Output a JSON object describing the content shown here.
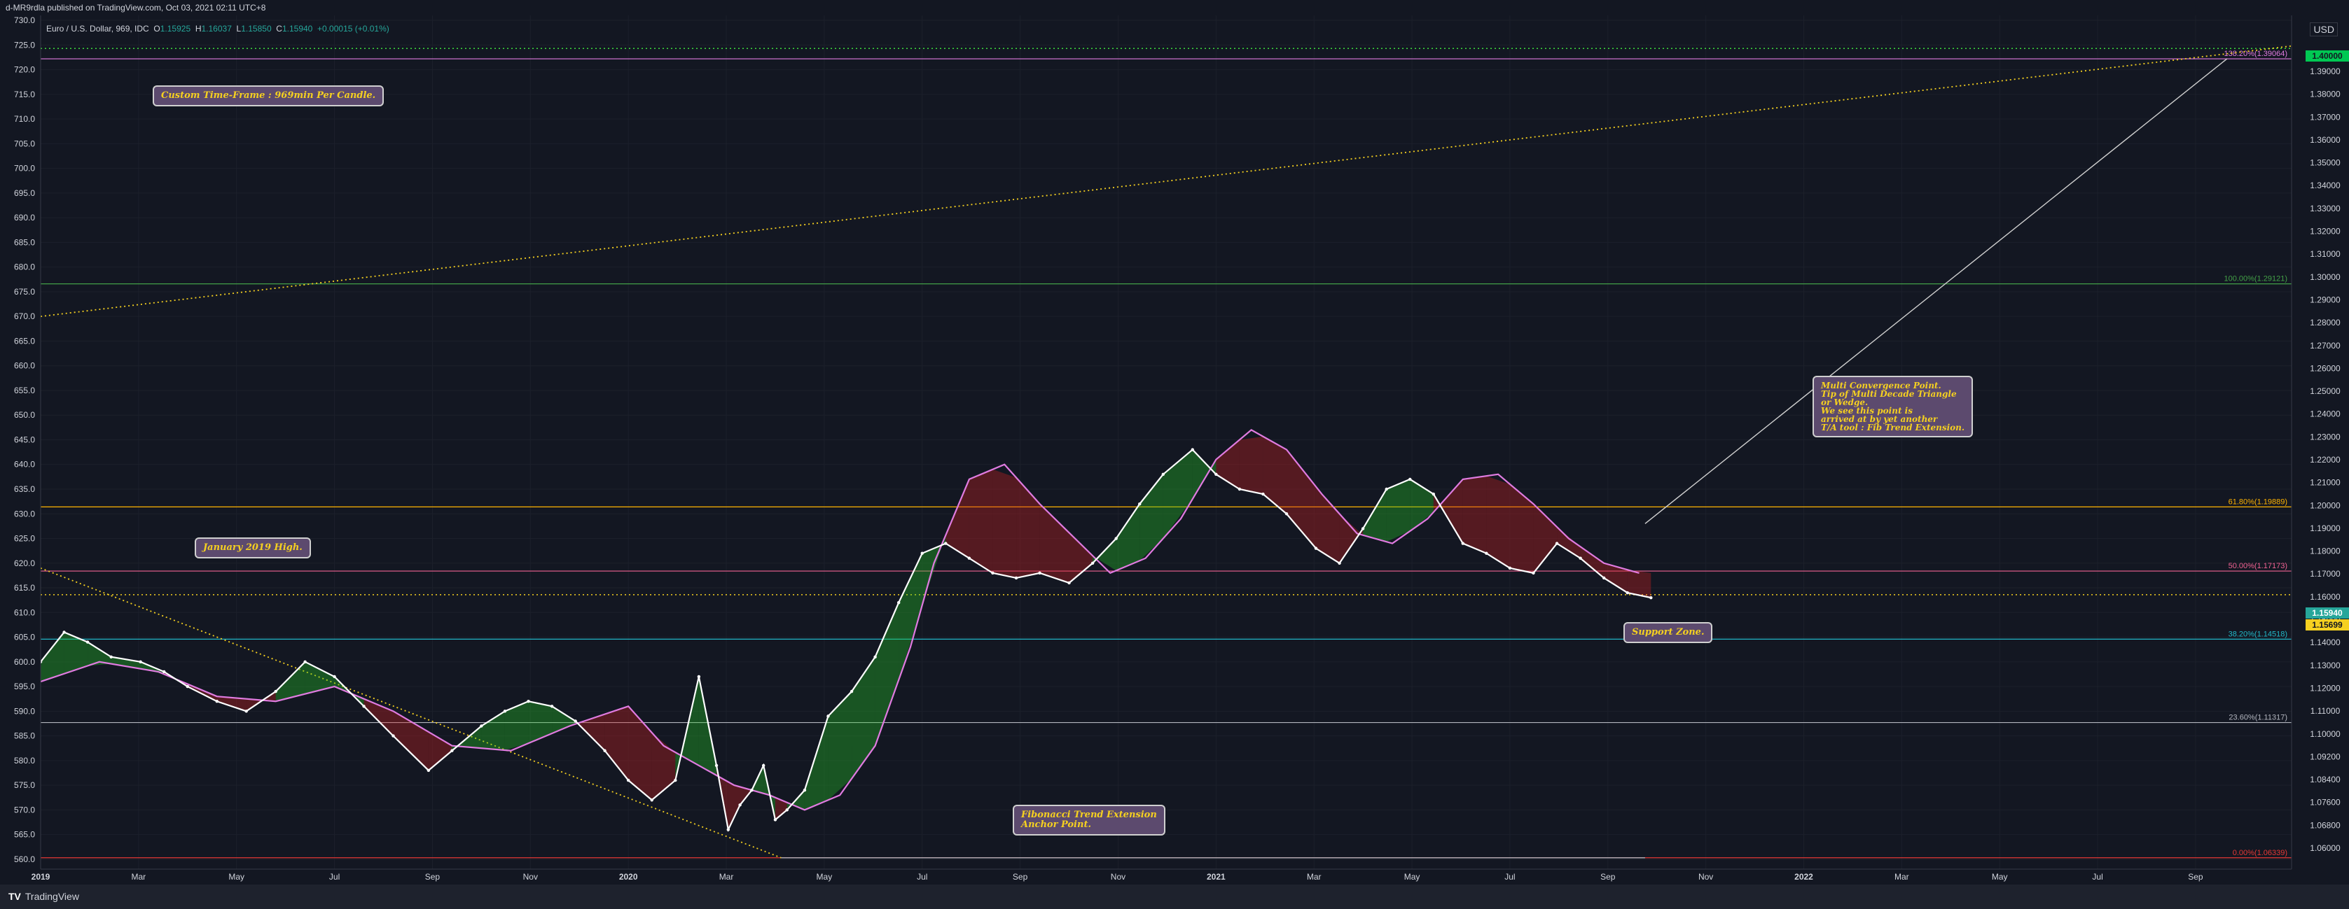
{
  "header": {
    "published": "d-MR9rdla published on TradingView.com, Oct 03, 2021 02:11 UTC+8"
  },
  "legend": {
    "symbol": "Euro / U.S. Dollar, 969, IDC",
    "o_label": "O",
    "o": "1.15925",
    "h_label": "H",
    "h": "1.16037",
    "l_label": "L",
    "l": "1.15850",
    "c_label": "C",
    "c": "1.15940",
    "change": "+0.00015 (+0.01%)"
  },
  "currency": "USD",
  "footer": {
    "brand": "TradingView"
  },
  "colors": {
    "background": "#131722",
    "grid": "#1c202b",
    "candle": "#ffffff",
    "ribbon_up": "#26c926",
    "ribbon_down": "#d02020",
    "sma": "#e07be0",
    "callout_bg": "#5c4a6e",
    "callout_text": "#f5d020"
  },
  "callouts": {
    "timeframe": "Custom Time-Frame : 969min Per Candle.",
    "jan2019": "January 2019 High.",
    "convergence": "Multi Convergence Point.\nTip of Multi Decade Triangle\nor Wedge.\nWe see this point is\narrived at by yet another\nT/A tool : Fib Trend Extension.",
    "support": "Support Zone.",
    "fib_anchor": "Fibonacci Trend Extension\nAnchor Point."
  },
  "price_tags": {
    "target": "1.40000",
    "last": "1.15940",
    "support": "1.15699"
  },
  "chart_data": {
    "type": "line",
    "title": "Euro / U.S. Dollar, 969, IDC",
    "left_axis": {
      "ticks": [
        560.0,
        565.0,
        570.0,
        575.0,
        580.0,
        585.0,
        590.0,
        595.0,
        600.0,
        605.0,
        610.0,
        615.0,
        620.0,
        625.0,
        630.0,
        635.0,
        640.0,
        645.0,
        650.0,
        655.0,
        660.0,
        665.0,
        670.0,
        675.0,
        680.0,
        685.0,
        690.0,
        695.0,
        700.0,
        705.0,
        710.0,
        715.0,
        720.0,
        725.0,
        730.0
      ],
      "range": [
        558,
        731
      ]
    },
    "right_axis": {
      "ticks": [
        "1.06000",
        "1.06800",
        "1.07600",
        "1.08400",
        "1.09200",
        "1.10000",
        "1.11000",
        "1.12000",
        "1.13000",
        "1.14000",
        "1.15000",
        "1.16000",
        "1.17000",
        "1.18000",
        "1.19000",
        "1.20000",
        "1.21000",
        "1.22000",
        "1.23000",
        "1.24000",
        "1.25000",
        "1.26000",
        "1.27000",
        "1.28000",
        "1.29000",
        "1.30000",
        "1.31000",
        "1.32000",
        "1.33000",
        "1.34000",
        "1.35000",
        "1.36000",
        "1.37000",
        "1.38000",
        "1.39000"
      ]
    },
    "x_ticks": [
      "2019",
      "Mar",
      "May",
      "Jul",
      "Sep",
      "Nov",
      "2020",
      "Mar",
      "May",
      "Jul",
      "Sep",
      "Nov",
      "2021",
      "Mar",
      "May",
      "Jul",
      "Sep",
      "Nov",
      "2022",
      "Mar",
      "May",
      "Jul",
      "Sep"
    ],
    "x_range": [
      2019.0,
      2022.83
    ],
    "fib_levels": [
      {
        "label": "0.00%(1.06339)",
        "value": 560.3,
        "color": "#e53935"
      },
      {
        "label": "23.60%(1.11317)",
        "value": 587.7,
        "color": "#b2b5be"
      },
      {
        "label": "38.20%(1.14518)",
        "value": 604.6,
        "color": "#22b8c8"
      },
      {
        "label": "50.00%(1.17173)",
        "value": 618.4,
        "color": "#f06292"
      },
      {
        "label": "61.80%(1.19889)",
        "value": 631.4,
        "color": "#ffb300"
      },
      {
        "label": "100.00%(1.29121)",
        "value": 676.6,
        "color": "#43a047"
      },
      {
        "label": "138.20%(1.39064)",
        "value": 722.2,
        "color": "#e07be0"
      }
    ],
    "horizontal_dotted": [
      {
        "value": 724.3,
        "color": "#3ddc3d"
      },
      {
        "value": 613.6,
        "color": "#f5d020"
      }
    ],
    "trend_lines": [
      {
        "from": [
          2019.0,
          670.0
        ],
        "to": [
          2022.83,
          724.8
        ],
        "color": "#f5d020",
        "style": "dotted"
      },
      {
        "from": [
          2019.0,
          619.0
        ],
        "to": [
          2020.26,
          560.3
        ],
        "color": "#f5d020",
        "style": "dotted"
      },
      {
        "from": [
          2020.26,
          560.3
        ],
        "to": [
          2021.73,
          560.3
        ],
        "color": "#b2b5be",
        "style": "solid"
      },
      {
        "from": [
          2021.73,
          628.0
        ],
        "to": [
          2022.72,
          722.2
        ],
        "color": "#d0d0d0",
        "style": "solid"
      }
    ],
    "close_series": {
      "x": [
        2019.0,
        2019.04,
        2019.08,
        2019.12,
        2019.17,
        2019.21,
        2019.25,
        2019.3,
        2019.35,
        2019.4,
        2019.45,
        2019.5,
        2019.55,
        2019.6,
        2019.66,
        2019.7,
        2019.75,
        2019.79,
        2019.83,
        2019.87,
        2019.91,
        2019.96,
        2020.0,
        2020.04,
        2020.08,
        2020.12,
        2020.15,
        2020.17,
        2020.19,
        2020.21,
        2020.23,
        2020.25,
        2020.27,
        2020.3,
        2020.34,
        2020.38,
        2020.42,
        2020.46,
        2020.5,
        2020.54,
        2020.58,
        2020.62,
        2020.66,
        2020.7,
        2020.75,
        2020.79,
        2020.83,
        2020.87,
        2020.91,
        2020.96,
        2021.0,
        2021.04,
        2021.08,
        2021.12,
        2021.17,
        2021.21,
        2021.25,
        2021.29,
        2021.33,
        2021.37,
        2021.42,
        2021.46,
        2021.5,
        2021.54,
        2021.58,
        2021.62,
        2021.66,
        2021.7,
        2021.74
      ],
      "y": [
        600.0,
        606.0,
        604.0,
        601.0,
        600.0,
        598.0,
        595.0,
        592.0,
        590.0,
        594.0,
        600.0,
        597.0,
        591.0,
        585.0,
        578.0,
        582.0,
        587.0,
        590.0,
        592.0,
        591.0,
        588.0,
        582.0,
        576.0,
        572.0,
        576.0,
        597.0,
        579.0,
        566.0,
        571.0,
        574.0,
        579.0,
        568.0,
        570.0,
        574.0,
        589.0,
        594.0,
        601.0,
        612.0,
        622.0,
        624.0,
        621.0,
        618.0,
        617.0,
        618.0,
        616.0,
        620.0,
        625.0,
        632.0,
        638.0,
        643.0,
        638.0,
        635.0,
        634.0,
        630.0,
        623.0,
        620.0,
        627.0,
        635.0,
        637.0,
        634.0,
        624.0,
        622.0,
        619.0,
        618.0,
        624.0,
        621.0,
        617.0,
        614.0,
        613.0
      ]
    },
    "sma_series": {
      "x": [
        2019.0,
        2019.1,
        2019.2,
        2019.3,
        2019.4,
        2019.5,
        2019.6,
        2019.7,
        2019.8,
        2019.9,
        2020.0,
        2020.06,
        2020.12,
        2020.18,
        2020.24,
        2020.3,
        2020.36,
        2020.42,
        2020.48,
        2020.52,
        2020.58,
        2020.64,
        2020.7,
        2020.76,
        2020.82,
        2020.88,
        2020.94,
        2021.0,
        2021.06,
        2021.12,
        2021.18,
        2021.24,
        2021.3,
        2021.36,
        2021.42,
        2021.48,
        2021.54,
        2021.6,
        2021.66,
        2021.72
      ],
      "y": [
        596.0,
        600.0,
        598.0,
        593.0,
        592.0,
        595.0,
        590.0,
        583.0,
        582.0,
        587.0,
        591.0,
        583.0,
        579.0,
        575.0,
        573.0,
        570.0,
        573.0,
        583.0,
        603.0,
        620.0,
        637.0,
        640.0,
        632.0,
        625.0,
        618.0,
        621.0,
        629.0,
        641.0,
        647.0,
        643.0,
        634.0,
        626.0,
        624.0,
        629.0,
        637.0,
        638.0,
        632.0,
        625.0,
        620.0,
        618.0
      ]
    }
  }
}
